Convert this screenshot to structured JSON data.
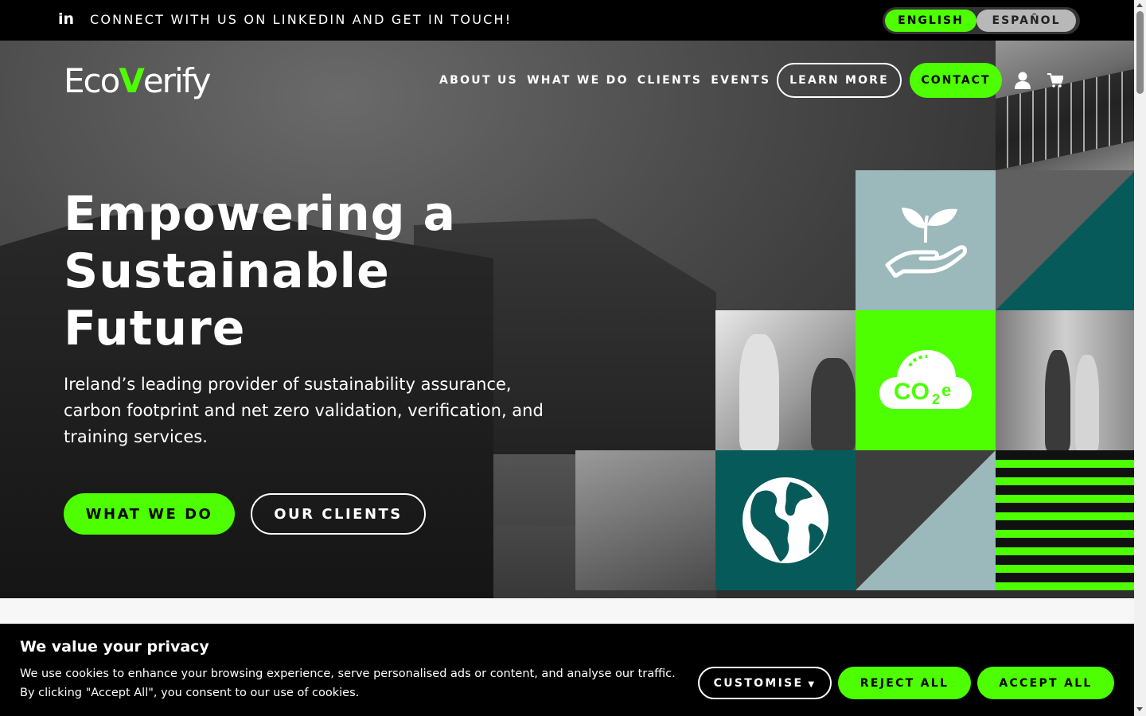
{
  "topbar": {
    "linkedin_icon": "linkedin-icon",
    "message": "CONNECT WITH US ON LINKEDIN AND GET IN TOUCH!",
    "languages": [
      "ENGLISH",
      "ESPAÑOL"
    ],
    "active_language": "ENGLISH"
  },
  "header": {
    "logo_part1": "Eco",
    "logo_part2": "V",
    "logo_part3": "erify",
    "nav": [
      "ABOUT US",
      "WHAT WE DO",
      "CLIENTS",
      "EVENTS"
    ],
    "learn_more": "LEARN MORE",
    "contact": "CONTACT",
    "account_icon": "user-icon",
    "cart_icon": "cart-icon"
  },
  "hero": {
    "headline_line1": "Empowering a",
    "headline_line2": "Sustainable",
    "headline_line3": "Future",
    "subtext": "Ireland’s leading provider of sustainability assurance, carbon footprint and net zero validation, verification, and training services.",
    "primary_button": "WHAT WE DO",
    "secondary_button": "OUR CLIENTS",
    "co2_label": "CO₂e"
  },
  "cookie_banner": {
    "title": "We value your privacy",
    "text": "We use cookies to enhance your browsing experience, serve personalised ads or content, and analyse our traffic. By clicking \"Accept All\", you consent to our use of cookies.",
    "customise": "CUSTOMISE",
    "reject": "REJECT ALL",
    "accept": "ACCEPT ALL"
  },
  "colors": {
    "accent_green": "#4dff00",
    "teal": "#075a5a",
    "pale_teal": "#9bb8bb",
    "black": "#000000"
  }
}
